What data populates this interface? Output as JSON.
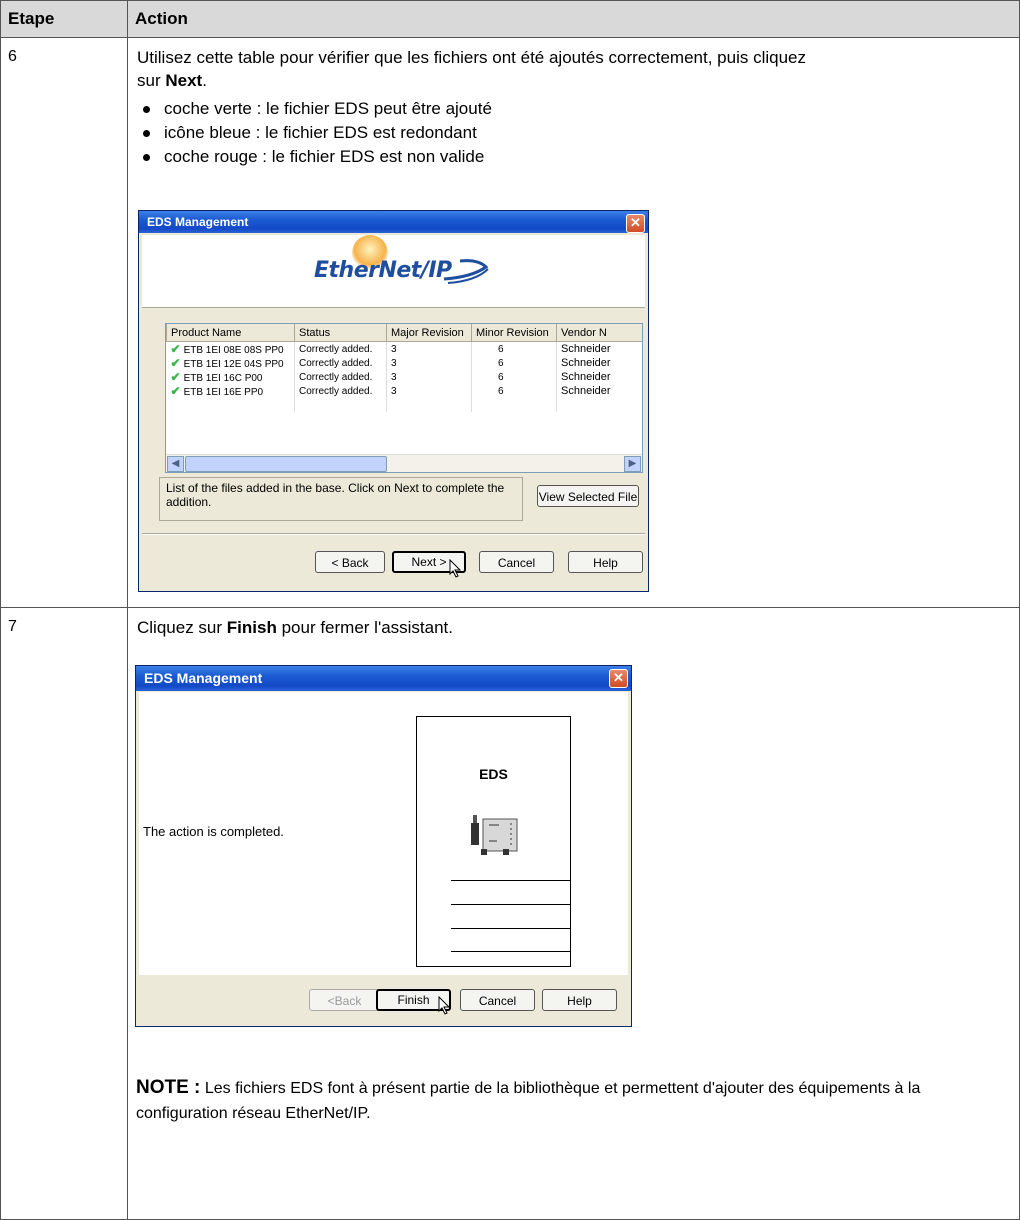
{
  "table": {
    "col_step": "Etape",
    "col_action": "Action"
  },
  "step6": {
    "number": "6",
    "intro_before": "Utilisez cette table pour vérifier que les fichiers ont été ajoutés correctement, puis cliquez sur",
    "intro_bold": "Next",
    "intro_after": ".",
    "bullets": [
      "coche verte : le fichier EDS peut être ajouté",
      "icône bleue : le fichier EDS est redondant",
      "coche rouge : le fichier EDS est non valide"
    ],
    "dialog": {
      "title": "EDS Management",
      "logo_text": "EtherNet/IP",
      "columns": [
        "Product Name",
        "Status",
        "Major Revision",
        "Minor Revision",
        "Vendor N"
      ],
      "rows": [
        [
          "ETB 1EI 08E 08S PP0",
          "Correctly added.",
          "3",
          "6",
          "Schneider"
        ],
        [
          "ETB 1EI 12E 04S PP0",
          "Correctly added.",
          "3",
          "6",
          "Schneider"
        ],
        [
          "ETB 1EI 16C P00",
          "Correctly added.",
          "3",
          "6",
          "Schneider"
        ],
        [
          "ETB 1EI 16E PP0",
          "Correctly added.",
          "3",
          "6",
          "Schneider"
        ]
      ],
      "info_text": "List of the files added in the base. Click on Next to complete the addition.",
      "view_button": "View Selected File",
      "back_button": "< Back",
      "next_button": "Next >",
      "cancel_button": "Cancel",
      "help_button": "Help"
    }
  },
  "step7": {
    "number": "7",
    "intro_before": "Cliquez sur",
    "intro_bold": "Finish",
    "intro_after": "pour fermer l'assistant.",
    "dialog": {
      "title": "EDS Management",
      "completed_text": "The action is completed.",
      "card_title": "EDS",
      "back_button": "<Back",
      "finish_button": "Finish",
      "cancel_button": "Cancel",
      "help_button": "Help"
    },
    "note_label": "NOTE :",
    "note_text": "Les fichiers EDS font à présent partie de la bibliothèque et permettent d'ajouter des équipements à la configuration réseau EtherNet/IP."
  }
}
